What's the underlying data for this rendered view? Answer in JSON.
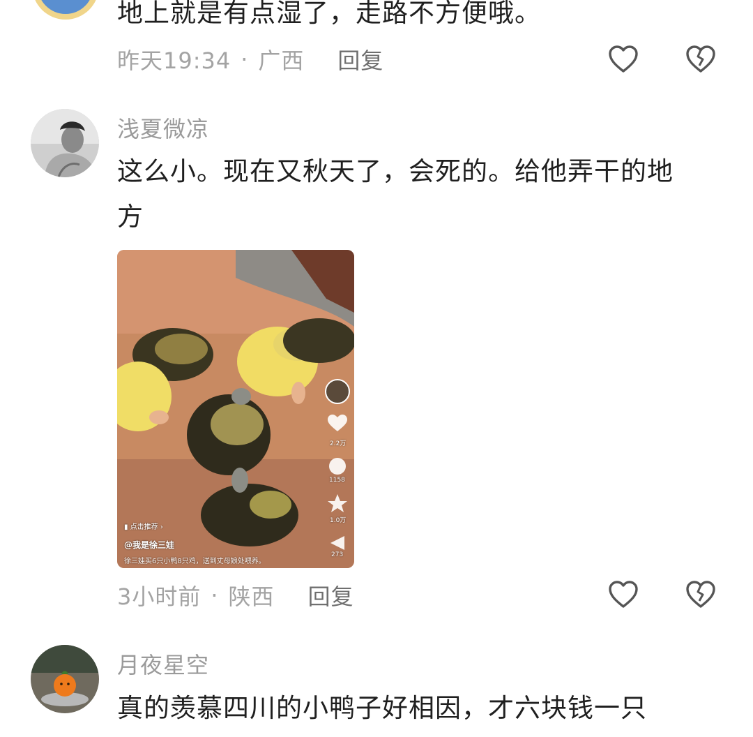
{
  "comments": [
    {
      "text": "地上就是有点湿了，走路不方便哦。",
      "time": "昨天19:34",
      "location": "广西",
      "reply_label": "回复"
    },
    {
      "username": "浅夏微凉",
      "text_line1": "这么小。现在又秋天了，会死的。给他弄干的地",
      "text_line2": "方",
      "time": "3小时前",
      "location": "陕西",
      "reply_label": "回复",
      "video": {
        "like_count": "2.2万",
        "comment_count": "1158",
        "fav_count": "1.0万",
        "share_count": "273",
        "promo_label": "点击推荐",
        "author": "@我是徐三娃",
        "caption": "徐三娃买6只小鸭8只鸡，送到丈母娘处喂养。"
      }
    },
    {
      "username": "月夜星空",
      "text": "真的羡慕四川的小鸭子好相因，才六块钱一只"
    }
  ],
  "icons": {
    "like": "heart-outline-icon",
    "dislike": "broken-heart-icon"
  },
  "colors": {
    "meta": "#a3a3a3",
    "text": "#1f1f1f",
    "icon": "#555555"
  }
}
